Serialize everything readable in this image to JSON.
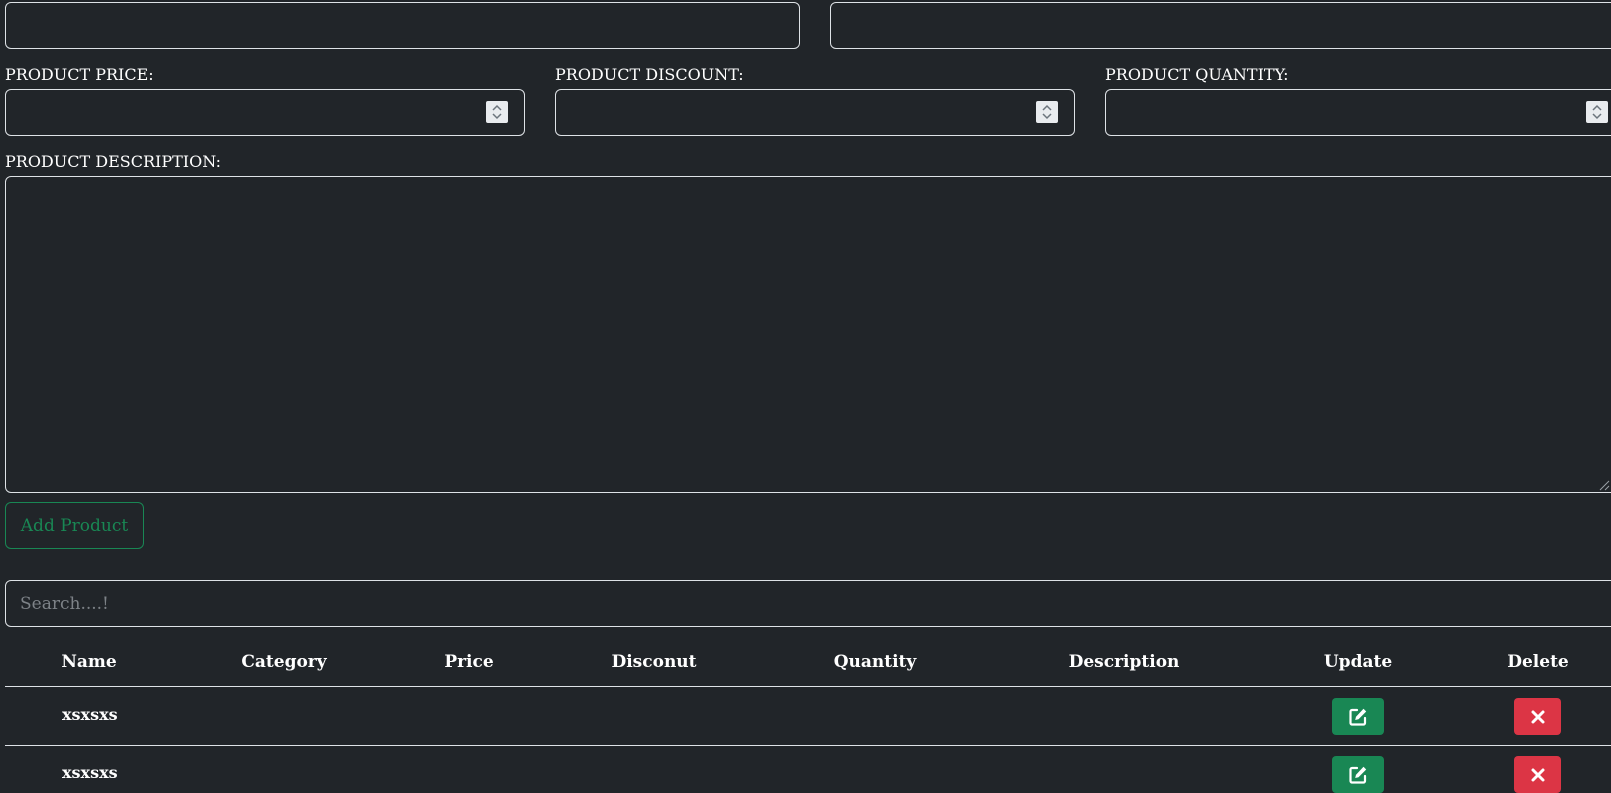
{
  "form": {
    "top_left_value": "",
    "top_right_value": "",
    "price_label": "PRODUCT PRICE:",
    "price_value": "",
    "discount_label": "PRODUCT DISCOUNT:",
    "discount_value": "",
    "quantity_label": "PRODUCT QUANTITY:",
    "quantity_value": "",
    "description_label": "PRODUCT DESCRIPTION:",
    "description_value": "",
    "add_button_label": "Add Product"
  },
  "search": {
    "placeholder": "Search....!",
    "value": ""
  },
  "table": {
    "headers": [
      "Name",
      "Category",
      "Price",
      "Disconut",
      "Quantity",
      "Description",
      "Update",
      "Delete"
    ],
    "rows": [
      {
        "name": "xsxsxs",
        "category": "",
        "price": "",
        "discount": "",
        "quantity": "",
        "description": ""
      },
      {
        "name": "xsxsxs",
        "category": "",
        "price": "",
        "discount": "",
        "quantity": "",
        "description": ""
      }
    ]
  },
  "icons": {
    "update": "edit-icon",
    "delete": "close-icon",
    "spinner": "chevron-up-down-icon"
  },
  "colors": {
    "background": "#212529",
    "success": "#198754",
    "danger": "#dc3545",
    "border": "#dee2e6"
  }
}
